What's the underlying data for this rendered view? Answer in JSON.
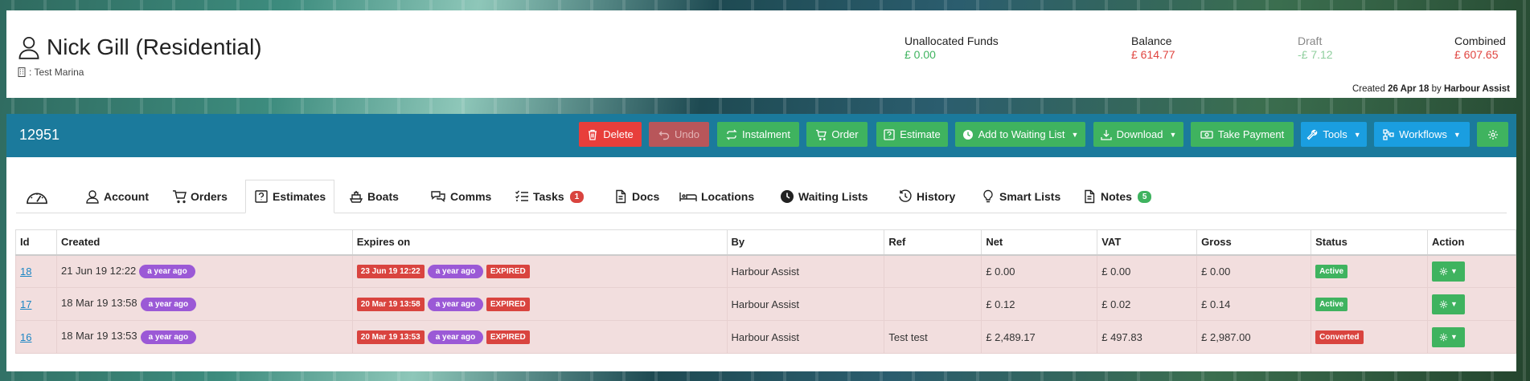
{
  "customer": {
    "name": "Nick Gill (Residential)",
    "site": ": Test Marina",
    "created_prefix": "Created",
    "created_date": "26 Apr 18",
    "created_by_prefix": "by",
    "created_by": "Harbour Assist"
  },
  "funds": [
    {
      "label": "Unallocated Funds",
      "value": "£ 0.00",
      "color": "#3fb35f"
    },
    {
      "label": "Balance",
      "value": "£ 614.77",
      "color": "#e0443f"
    },
    {
      "label": "Draft",
      "value": "-£ 7.12",
      "color": "#8fcf9e"
    },
    {
      "label": "Combined",
      "value": "£ 607.65",
      "color": "#e0443f"
    }
  ],
  "toolbar": {
    "record_id": "12951",
    "delete": "Delete",
    "undo": "Undo",
    "instalment": "Instalment",
    "order": "Order",
    "estimate": "Estimate",
    "waiting_list": "Add to Waiting List",
    "download": "Download",
    "take_payment": "Take Payment",
    "tools": "Tools",
    "workflows": "Workflows"
  },
  "tabs": {
    "account": "Account",
    "orders": "Orders",
    "estimates": "Estimates",
    "boats": "Boats",
    "comms": "Comms",
    "tasks": "Tasks",
    "tasks_count": "1",
    "docs": "Docs",
    "locations": "Locations",
    "waiting_lists": "Waiting Lists",
    "history": "History",
    "smart_lists": "Smart Lists",
    "notes": "Notes",
    "notes_count": "5",
    "active": "Estimates"
  },
  "table": {
    "headers": [
      "Id",
      "Created",
      "Expires on",
      "By",
      "Ref",
      "Net",
      "VAT",
      "Gross",
      "Status",
      "Action"
    ],
    "rows": [
      {
        "id": "18",
        "created": "21 Jun 19 12:22",
        "created_ago": "a year ago",
        "expires": "23 Jun 19 12:22",
        "expires_ago": "a year ago",
        "expired": "EXPIRED",
        "by": "Harbour Assist",
        "ref": "",
        "net": "£ 0.00",
        "vat": "£ 0.00",
        "gross": "£ 0.00",
        "status": "Active"
      },
      {
        "id": "17",
        "created": "18 Mar 19 13:58",
        "created_ago": "a year ago",
        "expires": "20 Mar 19 13:58",
        "expires_ago": "a year ago",
        "expired": "EXPIRED",
        "by": "Harbour Assist",
        "ref": "",
        "net": "£ 0.12",
        "vat": "£ 0.02",
        "gross": "£ 0.14",
        "status": "Active"
      },
      {
        "id": "16",
        "created": "18 Mar 19 13:53",
        "created_ago": "a year ago",
        "expires": "20 Mar 19 13:53",
        "expires_ago": "a year ago",
        "expired": "EXPIRED",
        "by": "Harbour Assist",
        "ref": "Test test",
        "net": "£ 2,489.17",
        "vat": "£ 497.83",
        "gross": "£ 2,987.00",
        "status": "Converted"
      }
    ]
  },
  "colors": {
    "toolbar_bg": "#1b7a9c",
    "danger": "#e83e3b",
    "danger_muted": "#b8565a",
    "success": "#3fb35f",
    "info": "#1a9ee0",
    "purple": "#9b59d6",
    "row_bg": "#f2dede",
    "status_active": "#3fb35f",
    "status_converted": "#d9443f"
  }
}
